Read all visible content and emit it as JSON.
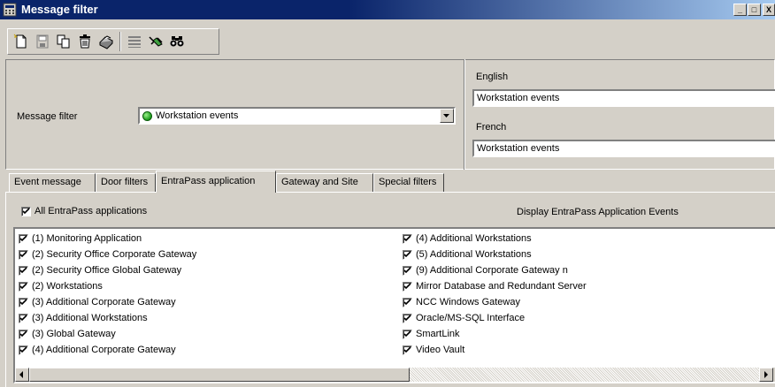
{
  "window": {
    "title": "Message filter",
    "minimize": "_",
    "maximize": "□",
    "close": "X"
  },
  "toolbar": {
    "buttons": [
      {
        "icon": "new-document-icon"
      },
      {
        "icon": "save-icon"
      },
      {
        "icon": "copy-icon"
      },
      {
        "icon": "delete-trash-icon"
      },
      {
        "icon": "print-icon"
      },
      {
        "icon": "list-icon"
      },
      {
        "icon": "link-icon"
      },
      {
        "icon": "find-binoculars-icon"
      }
    ]
  },
  "header": {
    "filter_label": "Message filter",
    "filter_value": "Workstation events",
    "english_label": "English",
    "english_value": "Workstation events",
    "french_label": "French",
    "french_value": "Workstation events"
  },
  "tabs": [
    {
      "label": "Event message"
    },
    {
      "label": "Door filters"
    },
    {
      "label": "EntraPass application",
      "active": true
    },
    {
      "label": "Gateway and Site"
    },
    {
      "label": "Special filters"
    }
  ],
  "panel": {
    "all_label": "All EntraPass applications",
    "all_checked": true,
    "caption": "Display EntraPass Application Events",
    "left_items": [
      "(1)  Monitoring Application",
      "(2)  Security Office Corporate Gateway",
      "(2)  Security Office Global Gateway",
      "(2)  Workstations",
      "(3)  Additional Corporate Gateway",
      "(3)  Additional Workstations",
      "(3)  Global Gateway",
      "(4)  Additional Corporate Gateway"
    ],
    "right_items": [
      "(4)  Additional Workstations",
      "(5)  Additional Workstations",
      "(9)  Additional Corporate Gateway n",
      "Mirror Database and Redundant Server",
      "NCC Windows Gateway",
      "Oracle/MS-SQL Interface",
      "SmartLink",
      "Video Vault"
    ]
  },
  "colors": {
    "titlebar": "#0a246a",
    "face": "#d4d0c8",
    "status_dot": "#1a9a1a"
  }
}
